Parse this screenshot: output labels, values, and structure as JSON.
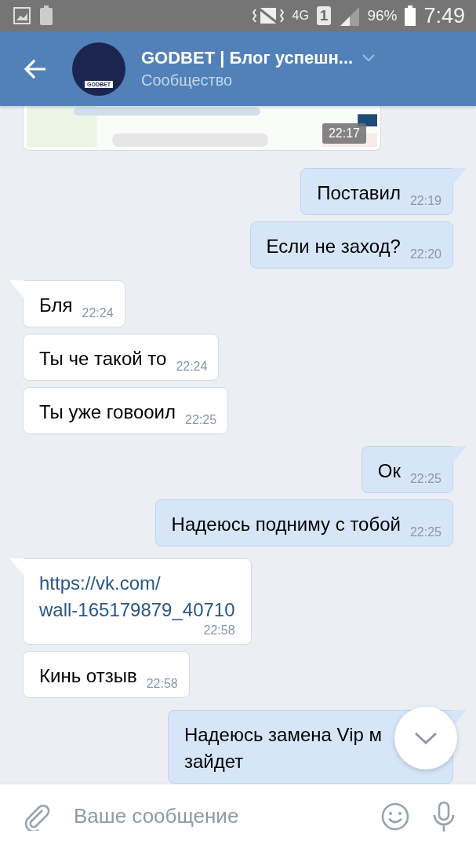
{
  "status_bar": {
    "network": "4G",
    "sim": "1",
    "battery": "96%",
    "time": "7:49"
  },
  "header": {
    "title": "GODBET | Блог успешн...",
    "subtitle": "Сообщество",
    "avatar_label": "GODBET"
  },
  "preview_card": {
    "kind": "picture",
    "time": "22:17"
  },
  "messages": [
    {
      "kind": "text",
      "outgoing": true,
      "tail": true,
      "lines": [
        "Поставил"
      ],
      "time": "22:19"
    },
    {
      "kind": "text",
      "outgoing": true,
      "tail": false,
      "lines": [
        "Если не заход?"
      ],
      "time": "22:20"
    },
    {
      "kind": "text",
      "outgoing": false,
      "tail": true,
      "lines": [
        "Бля"
      ],
      "time": "22:24"
    },
    {
      "kind": "text",
      "outgoing": false,
      "tail": false,
      "lines": [
        "Ты че такой то"
      ],
      "time": "22:24"
    },
    {
      "kind": "text",
      "outgoing": false,
      "tail": false,
      "lines": [
        "Ты уже говооил"
      ],
      "time": "22:25"
    },
    {
      "kind": "text",
      "outgoing": true,
      "tail": true,
      "lines": [
        "Ок"
      ],
      "time": "22:25"
    },
    {
      "kind": "text",
      "outgoing": true,
      "tail": false,
      "lines": [
        "Надеюсь подниму с тобой"
      ],
      "time": "22:25"
    },
    {
      "kind": "link",
      "outgoing": false,
      "tail": true,
      "lines": [
        "https://vk.com/",
        "wall-165179879_40710"
      ],
      "time": "22:58"
    },
    {
      "kind": "text",
      "outgoing": false,
      "tail": false,
      "lines": [
        "Кинь отзыв"
      ],
      "time": "22:58"
    },
    {
      "kind": "block",
      "outgoing": true,
      "tail": true,
      "lines": [
        "Надеюсь замена Vip м",
        "зайдет"
      ]
    }
  ],
  "composer": {
    "placeholder": "Ваше сообщение"
  }
}
